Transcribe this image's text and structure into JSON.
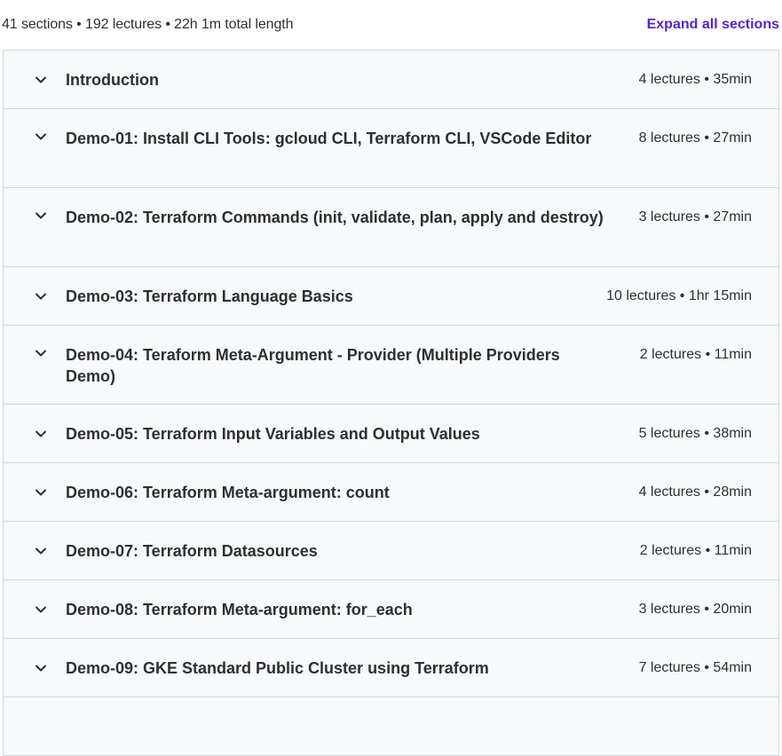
{
  "summary": {
    "text": "41 sections • 192 lectures • 22h 1m total length",
    "expand_label": "Expand all sections"
  },
  "colors": {
    "accent": "#5624d0",
    "row_bg": "#f7f9fa",
    "border": "#d1d7dc",
    "text": "#2d2f31"
  },
  "sections": [
    {
      "title": "Introduction",
      "meta": "4 lectures • 35min",
      "icon": "chevron-down-icon"
    },
    {
      "title": "Demo-01: Install CLI Tools: gcloud CLI, Terraform CLI, VSCode Editor",
      "meta": "8 lectures • 27min",
      "icon": "chevron-down-icon"
    },
    {
      "title": "Demo-02: Terraform Commands (init, validate, plan, apply and destroy)",
      "meta": "3 lectures • 27min",
      "icon": "chevron-down-icon"
    },
    {
      "title": "Demo-03: Terraform Language Basics",
      "meta": "10 lectures • 1hr 15min",
      "icon": "chevron-down-icon"
    },
    {
      "title": "Demo-04: Teraform Meta-Argument - Provider (Multiple Providers Demo)",
      "meta": "2 lectures • 11min",
      "icon": "chevron-down-icon"
    },
    {
      "title": "Demo-05: Terraform Input Variables and Output Values",
      "meta": "5 lectures • 38min",
      "icon": "chevron-down-icon"
    },
    {
      "title": "Demo-06: Terraform Meta-argument: count",
      "meta": "4 lectures • 28min",
      "icon": "chevron-down-icon"
    },
    {
      "title": "Demo-07: Terraform Datasources",
      "meta": "2 lectures • 11min",
      "icon": "chevron-down-icon"
    },
    {
      "title": "Demo-08: Terraform Meta-argument: for_each",
      "meta": "3 lectures • 20min",
      "icon": "chevron-down-icon"
    },
    {
      "title": "Demo-09: GKE Standard Public Cluster using Terraform",
      "meta": "7 lectures • 54min",
      "icon": "chevron-down-icon"
    }
  ]
}
